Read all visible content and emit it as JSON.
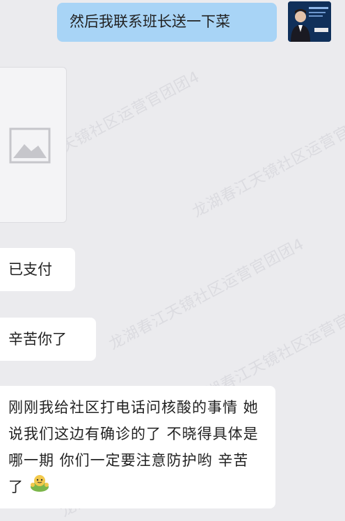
{
  "watermark_text": "龙湖春江天镜社区运营官团团4",
  "messages": {
    "outgoing_1": "然后我联系班长送一下菜",
    "incoming_paid": "已支付",
    "incoming_thanks": "辛苦你了",
    "incoming_long": "刚刚我给社区打电话问核酸的事情 她说我们这边有确诊的了 不晓得具体是哪一期 你们一定要注意防护哟 辛苦了"
  },
  "icons": {
    "image_placeholder": "image-placeholder-icon",
    "emoji": "hands-emoji-icon"
  },
  "colors": {
    "outgoing_bubble": "#a8d4f6",
    "incoming_bubble": "#ffffff",
    "background": "#ebebee"
  }
}
